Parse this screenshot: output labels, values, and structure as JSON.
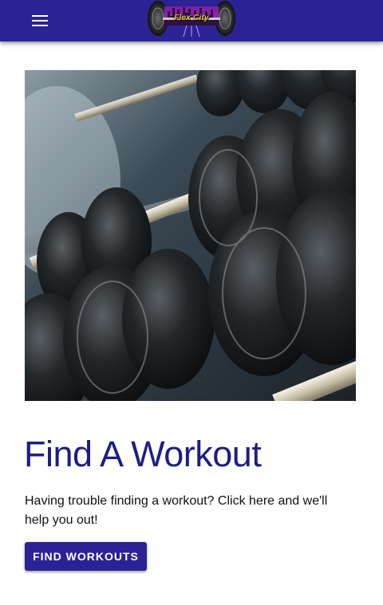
{
  "app": {
    "logo_text": "Flex City",
    "menu_icon": "hamburger-menu-icon",
    "brand_color": "#2b2295",
    "title_color": "#1e1d85"
  },
  "hero": {
    "image_subject": "rack of dumbbells"
  },
  "content": {
    "title": "Find A Workout",
    "description": "Having trouble finding a workout? Click here and we'll help you out!",
    "button_label": "FIND WORKOUTS"
  }
}
